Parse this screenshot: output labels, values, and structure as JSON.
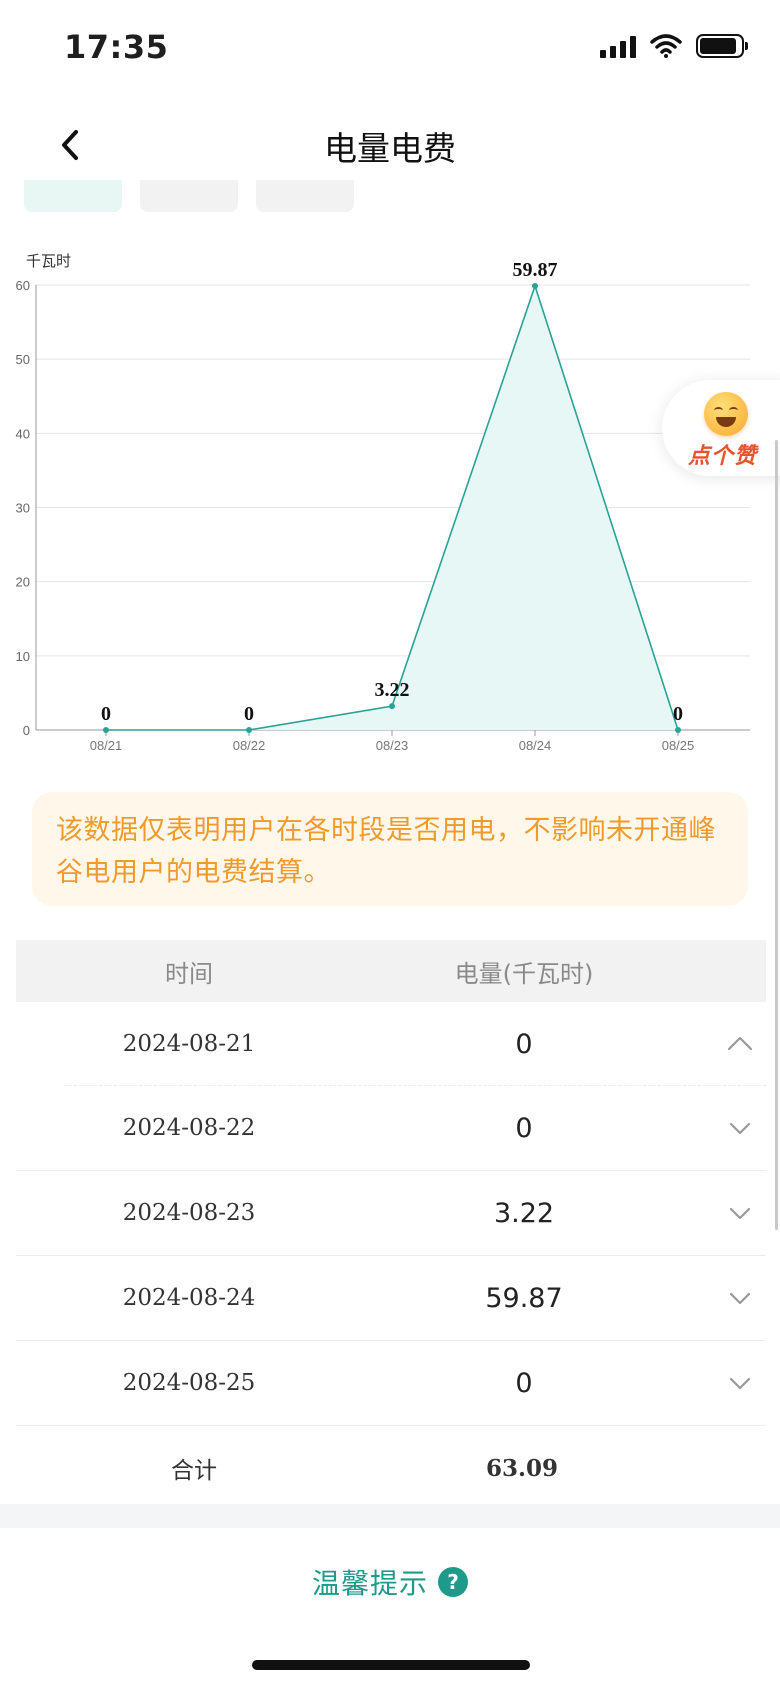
{
  "status_bar": {
    "time": "17:35"
  },
  "header": {
    "title": "电量电费"
  },
  "colors": {
    "accent": "#1e9a8b",
    "chart_line": "#2aa394",
    "chart_fill": "#e7f7f5",
    "notice_text": "#f09a2c",
    "notice_bg": "#fff8ea",
    "like_text": "#e8532b"
  },
  "icons": {
    "back": "chevron-left-icon",
    "expand": "chevron-down-icon",
    "collapse": "chevron-up-icon",
    "help": "question-circle-icon",
    "like": "smile-emoji-icon"
  },
  "chart_data": {
    "type": "area",
    "ylabel": "千瓦时",
    "categories": [
      "08/21",
      "08/22",
      "08/23",
      "08/24",
      "08/25"
    ],
    "values": [
      0,
      0,
      3.22,
      59.87,
      0
    ],
    "data_labels": [
      "0",
      "0",
      "3.22",
      "59.87",
      "0"
    ],
    "yticks": [
      0,
      10,
      20,
      30,
      40,
      50,
      60
    ],
    "ylim": [
      0,
      60
    ],
    "grid": true,
    "legend": "none"
  },
  "like_float": {
    "label": "点个赞"
  },
  "notice": {
    "text": "该数据仅表明用户在各时段是否用电，不影响未开通峰谷电用户的电费结算。"
  },
  "table": {
    "headers": {
      "time": "时间",
      "energy": "电量(千瓦时)"
    },
    "rows": [
      {
        "date": "2024-08-21",
        "value": "0",
        "expanded": true
      },
      {
        "date": "2024-08-22",
        "value": "0",
        "expanded": false
      },
      {
        "date": "2024-08-23",
        "value": "3.22",
        "expanded": false
      },
      {
        "date": "2024-08-24",
        "value": "59.87",
        "expanded": false
      },
      {
        "date": "2024-08-25",
        "value": "0",
        "expanded": false
      }
    ],
    "total_label": "合计",
    "total_value": "63.09"
  },
  "tips": {
    "label": "温馨提示",
    "help_glyph": "?"
  }
}
